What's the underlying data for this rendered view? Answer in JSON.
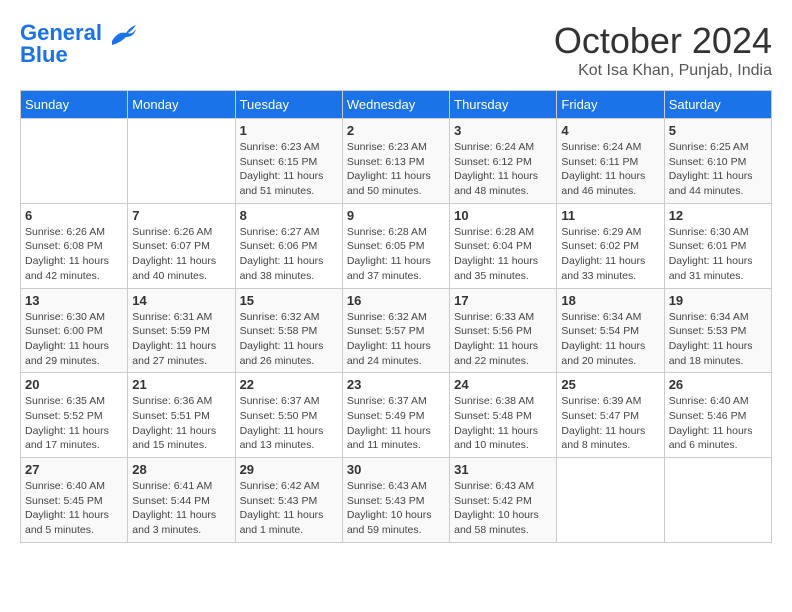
{
  "header": {
    "logo_line1": "General",
    "logo_line2": "Blue",
    "month": "October 2024",
    "location": "Kot Isa Khan, Punjab, India"
  },
  "weekdays": [
    "Sunday",
    "Monday",
    "Tuesday",
    "Wednesday",
    "Thursday",
    "Friday",
    "Saturday"
  ],
  "weeks": [
    [
      {
        "day": "",
        "info": ""
      },
      {
        "day": "",
        "info": ""
      },
      {
        "day": "1",
        "info": "Sunrise: 6:23 AM\nSunset: 6:15 PM\nDaylight: 11 hours and 51 minutes."
      },
      {
        "day": "2",
        "info": "Sunrise: 6:23 AM\nSunset: 6:13 PM\nDaylight: 11 hours and 50 minutes."
      },
      {
        "day": "3",
        "info": "Sunrise: 6:24 AM\nSunset: 6:12 PM\nDaylight: 11 hours and 48 minutes."
      },
      {
        "day": "4",
        "info": "Sunrise: 6:24 AM\nSunset: 6:11 PM\nDaylight: 11 hours and 46 minutes."
      },
      {
        "day": "5",
        "info": "Sunrise: 6:25 AM\nSunset: 6:10 PM\nDaylight: 11 hours and 44 minutes."
      }
    ],
    [
      {
        "day": "6",
        "info": "Sunrise: 6:26 AM\nSunset: 6:08 PM\nDaylight: 11 hours and 42 minutes."
      },
      {
        "day": "7",
        "info": "Sunrise: 6:26 AM\nSunset: 6:07 PM\nDaylight: 11 hours and 40 minutes."
      },
      {
        "day": "8",
        "info": "Sunrise: 6:27 AM\nSunset: 6:06 PM\nDaylight: 11 hours and 38 minutes."
      },
      {
        "day": "9",
        "info": "Sunrise: 6:28 AM\nSunset: 6:05 PM\nDaylight: 11 hours and 37 minutes."
      },
      {
        "day": "10",
        "info": "Sunrise: 6:28 AM\nSunset: 6:04 PM\nDaylight: 11 hours and 35 minutes."
      },
      {
        "day": "11",
        "info": "Sunrise: 6:29 AM\nSunset: 6:02 PM\nDaylight: 11 hours and 33 minutes."
      },
      {
        "day": "12",
        "info": "Sunrise: 6:30 AM\nSunset: 6:01 PM\nDaylight: 11 hours and 31 minutes."
      }
    ],
    [
      {
        "day": "13",
        "info": "Sunrise: 6:30 AM\nSunset: 6:00 PM\nDaylight: 11 hours and 29 minutes."
      },
      {
        "day": "14",
        "info": "Sunrise: 6:31 AM\nSunset: 5:59 PM\nDaylight: 11 hours and 27 minutes."
      },
      {
        "day": "15",
        "info": "Sunrise: 6:32 AM\nSunset: 5:58 PM\nDaylight: 11 hours and 26 minutes."
      },
      {
        "day": "16",
        "info": "Sunrise: 6:32 AM\nSunset: 5:57 PM\nDaylight: 11 hours and 24 minutes."
      },
      {
        "day": "17",
        "info": "Sunrise: 6:33 AM\nSunset: 5:56 PM\nDaylight: 11 hours and 22 minutes."
      },
      {
        "day": "18",
        "info": "Sunrise: 6:34 AM\nSunset: 5:54 PM\nDaylight: 11 hours and 20 minutes."
      },
      {
        "day": "19",
        "info": "Sunrise: 6:34 AM\nSunset: 5:53 PM\nDaylight: 11 hours and 18 minutes."
      }
    ],
    [
      {
        "day": "20",
        "info": "Sunrise: 6:35 AM\nSunset: 5:52 PM\nDaylight: 11 hours and 17 minutes."
      },
      {
        "day": "21",
        "info": "Sunrise: 6:36 AM\nSunset: 5:51 PM\nDaylight: 11 hours and 15 minutes."
      },
      {
        "day": "22",
        "info": "Sunrise: 6:37 AM\nSunset: 5:50 PM\nDaylight: 11 hours and 13 minutes."
      },
      {
        "day": "23",
        "info": "Sunrise: 6:37 AM\nSunset: 5:49 PM\nDaylight: 11 hours and 11 minutes."
      },
      {
        "day": "24",
        "info": "Sunrise: 6:38 AM\nSunset: 5:48 PM\nDaylight: 11 hours and 10 minutes."
      },
      {
        "day": "25",
        "info": "Sunrise: 6:39 AM\nSunset: 5:47 PM\nDaylight: 11 hours and 8 minutes."
      },
      {
        "day": "26",
        "info": "Sunrise: 6:40 AM\nSunset: 5:46 PM\nDaylight: 11 hours and 6 minutes."
      }
    ],
    [
      {
        "day": "27",
        "info": "Sunrise: 6:40 AM\nSunset: 5:45 PM\nDaylight: 11 hours and 5 minutes."
      },
      {
        "day": "28",
        "info": "Sunrise: 6:41 AM\nSunset: 5:44 PM\nDaylight: 11 hours and 3 minutes."
      },
      {
        "day": "29",
        "info": "Sunrise: 6:42 AM\nSunset: 5:43 PM\nDaylight: 11 hours and 1 minute."
      },
      {
        "day": "30",
        "info": "Sunrise: 6:43 AM\nSunset: 5:43 PM\nDaylight: 10 hours and 59 minutes."
      },
      {
        "day": "31",
        "info": "Sunrise: 6:43 AM\nSunset: 5:42 PM\nDaylight: 10 hours and 58 minutes."
      },
      {
        "day": "",
        "info": ""
      },
      {
        "day": "",
        "info": ""
      }
    ]
  ]
}
